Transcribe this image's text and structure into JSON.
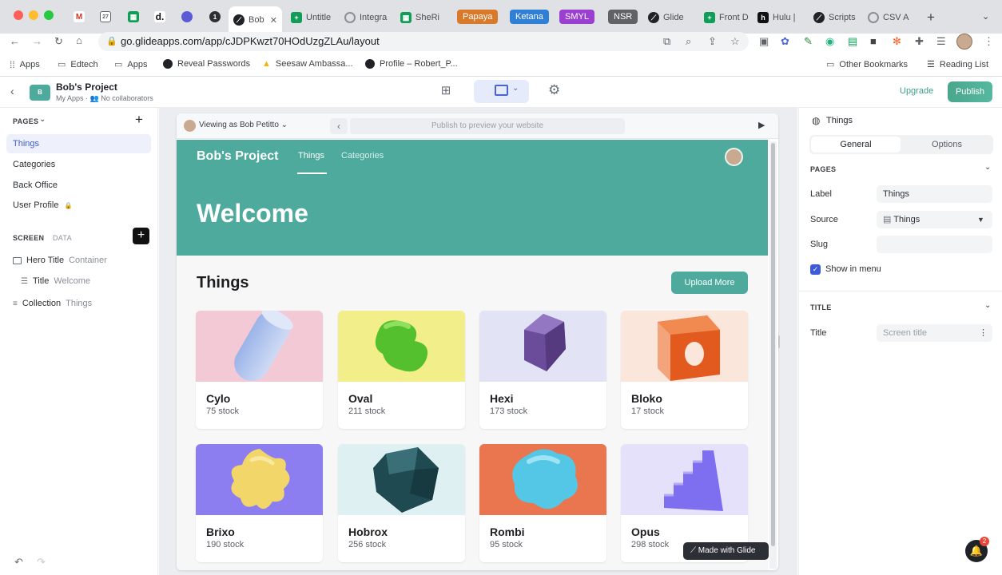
{
  "browser": {
    "tabs": [
      "Bob",
      "Untitle",
      "Integra",
      "SheRi",
      "Glide",
      "Front D",
      "Hulu |",
      "Scripts",
      "CSV A"
    ],
    "tab_groups": [
      {
        "label": "Papaya",
        "color": "#d97a2b"
      },
      {
        "label": "Ketana",
        "color": "#2f7fd6"
      },
      {
        "label": "SMYL",
        "color": "#9b3fd0"
      },
      {
        "label": "NSR",
        "color": "#5f6368"
      }
    ],
    "url": "go.glideapps.com/app/cJDPKwzt70HOdUzgZLAu/layout",
    "bookmarks": [
      "Apps",
      "Edtech",
      "Apps",
      "Reveal Passwords",
      "Seesaw Ambassa...",
      "Profile – Robert_P..."
    ],
    "other_bookmarks": "Other Bookmarks",
    "reading_list": "Reading List"
  },
  "app": {
    "avatar_letter": "B",
    "name": "Bob's Project",
    "breadcrumb": "My Apps",
    "collaborators": "No collaborators",
    "upgrade_label": "Upgrade",
    "publish_label": "Publish"
  },
  "sidebar": {
    "pages_heading": "PAGES",
    "pages": [
      "Things",
      "Categories",
      "Back Office",
      "User Profile"
    ],
    "screen_tab": "SCREEN",
    "data_tab": "DATA",
    "layers": [
      {
        "name": "Hero Title",
        "type": "Container"
      },
      {
        "name": "Title",
        "type": "Welcome"
      },
      {
        "name": "Collection",
        "type": "Things"
      }
    ]
  },
  "preview": {
    "viewing_as": "Viewing as Bob Petitto",
    "url_placeholder": "Publish to preview your website",
    "app_title": "Bob's Project",
    "nav_tabs": [
      "Things",
      "Categories"
    ],
    "hero_text": "Welcome",
    "collection_title": "Things",
    "upload_label": "Upload More",
    "items": [
      {
        "name": "Cylo",
        "stock": "75 stock",
        "bg": "#f3c9d5"
      },
      {
        "name": "Oval",
        "stock": "211 stock",
        "bg": "#f2ee8a"
      },
      {
        "name": "Hexi",
        "stock": "173 stock",
        "bg": "#e2e3f5"
      },
      {
        "name": "Bloko",
        "stock": "17 stock",
        "bg": "#fbe6dc"
      },
      {
        "name": "Brixo",
        "stock": "190 stock",
        "bg": "#8c7ef0"
      },
      {
        "name": "Hobrox",
        "stock": "256 stock",
        "bg": "#dff0f3"
      },
      {
        "name": "Rombi",
        "stock": "95 stock",
        "bg": "#ea7650"
      },
      {
        "name": "Opus",
        "stock": "298 stock",
        "bg": "#e6e1fb"
      }
    ],
    "made_with": "Made with Glide"
  },
  "inspector": {
    "title": "Things",
    "tabs": [
      "General",
      "Options"
    ],
    "pages_heading": "PAGES",
    "label_label": "Label",
    "label_value": "Things",
    "source_label": "Source",
    "source_value": "Things",
    "slug_label": "Slug",
    "show_in_menu": "Show in menu",
    "title_heading": "TITLE",
    "title_label": "Title",
    "title_placeholder": "Screen title"
  },
  "notifications_count": "2"
}
